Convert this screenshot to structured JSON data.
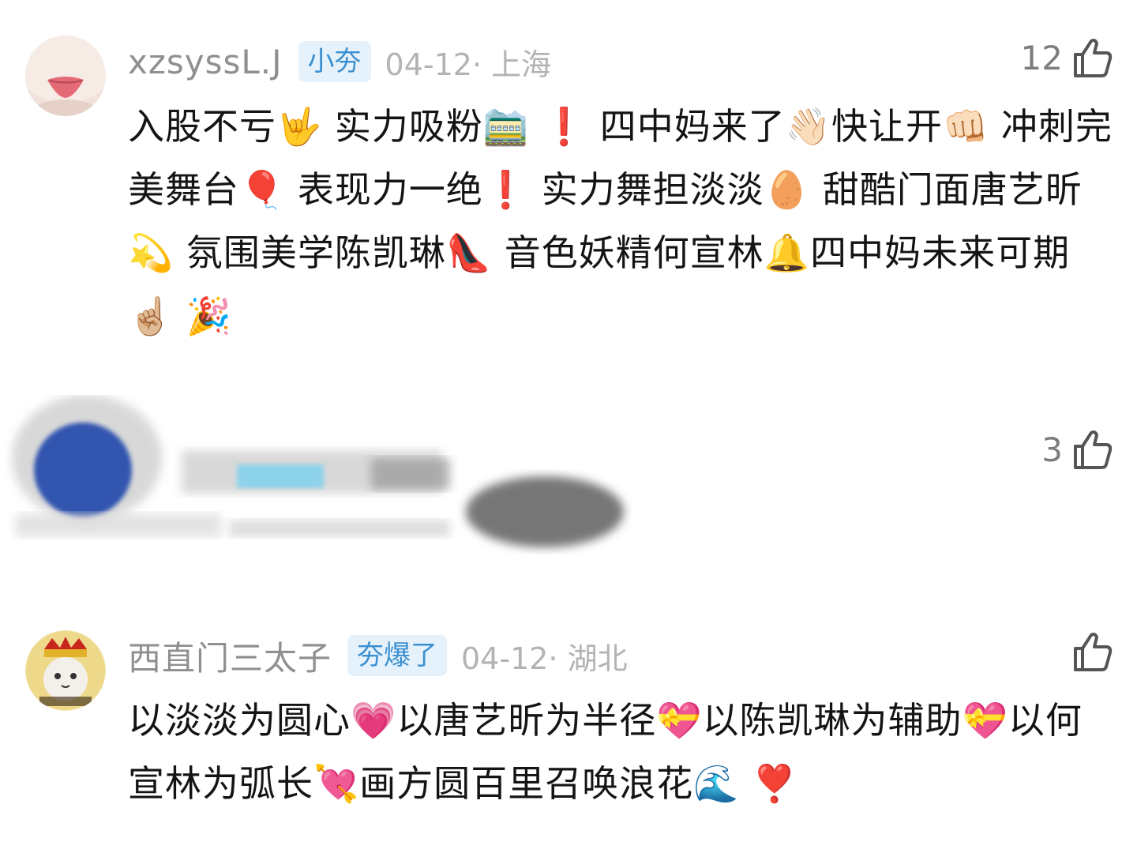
{
  "comments": [
    {
      "username": "xzsyssL.J",
      "badge": "小夯",
      "date": "04-12· 上海",
      "likes": "12",
      "text": "入股不亏🤟 实力吸粉🚞 ❗ 四中妈来了👋🏻快让开👊🏻 冲刺完美舞台🎈 表现力一绝❗ 实力舞担淡淡🥚 甜酷门面唐艺昕💫 氛围美学陈凯琳👠 音色妖精何宣林🔔四中妈未来可期☝🏼 🎉"
    },
    {
      "likes": "3"
    },
    {
      "username": "西直门三太子",
      "badge": "夯爆了",
      "date": "04-12· 湖北",
      "likes": "",
      "text": "以淡淡为圆心💗以唐艺昕为半径💝以陈凯琳为辅助💝以何宣林为弧长💘画方圆百里召唤浪花🌊 ❣️"
    }
  ],
  "colors": {
    "username": "#8f8f8f",
    "badge_bg": "#e6f2fb",
    "badge_text": "#3a8fd0",
    "date": "#b3b3b3",
    "body": "#141414"
  },
  "icons": {
    "like": "thumbs-up-icon"
  }
}
